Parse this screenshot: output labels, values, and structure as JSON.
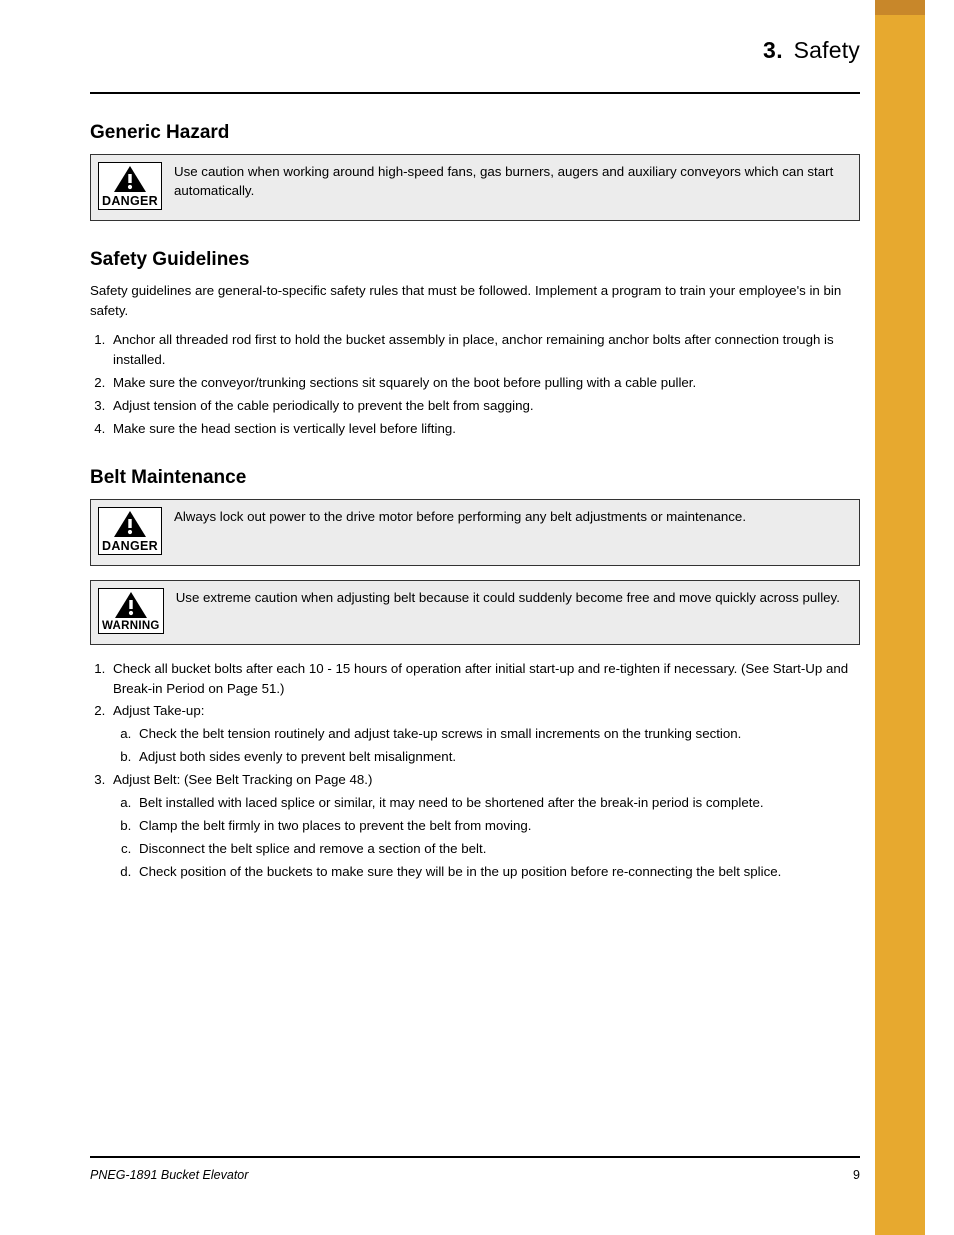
{
  "header": {
    "chapter_num": "3.",
    "chapter_title": "Safety"
  },
  "sections": {
    "generic_hazard": {
      "title": "Generic Hazard",
      "danger_text": "Use caution when working around high-speed fans, gas burners, augers and auxiliary conveyors which can start automatically."
    },
    "safety_guidelines": {
      "title": "Safety Guidelines",
      "intro": "Safety guidelines are general-to-specific safety rules that must be followed. Implement a program to train your employee's in bin safety.",
      "items": [
        "Anchor all threaded rod first to hold the bucket assembly in place, anchor remaining anchor bolts after connection trough is installed.",
        "Make sure the conveyor/trunking sections sit squarely on the boot before pulling with a cable puller.",
        "Adjust tension of the cable periodically to prevent the belt from sagging.",
        "Make sure the head section is vertically level before lifting."
      ]
    },
    "belt_maintenance": {
      "title": "Belt Maintenance",
      "danger_text": "Always lock out power to the drive motor before performing any belt adjustments or maintenance.",
      "warning_text": "Use extreme caution when adjusting belt because it could suddenly become free and move quickly across pulley.",
      "items": [
        {
          "text": "Check all bucket bolts after each 10 - 15 hours of operation after initial start-up and re-tighten if necessary. (See Start-Up and Break-in Period on Page 51.)"
        },
        {
          "text": "Adjust Take-up:",
          "subs": [
            "Check the belt tension routinely and adjust take-up screws in small increments on the trunking section.",
            "Adjust both sides evenly to prevent belt misalignment."
          ]
        },
        {
          "text": "Adjust Belt: (See Belt Tracking on Page 48.)",
          "subs": [
            "Belt installed with laced splice or similar, it may need to be shortened after the break-in period is complete.",
            "Clamp the belt firmly in two places to prevent the belt from moving.",
            "Disconnect the belt splice and remove a section of the belt.",
            "Check position of the buckets to make sure they will be in the up position before re-connecting the belt splice."
          ]
        }
      ]
    }
  },
  "footer": {
    "left": "PNEG-1891 Bucket Elevator",
    "right": "9"
  },
  "icon": {
    "danger": "DANGER",
    "warning": "WARNING"
  }
}
